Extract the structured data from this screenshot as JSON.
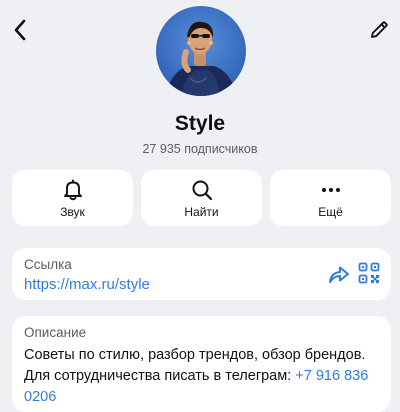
{
  "header": {
    "back_icon": "chevron-left-icon",
    "edit_icon": "pencil-icon"
  },
  "channel": {
    "name": "Style",
    "subscribers": "27 935 подписчиков"
  },
  "actions": [
    {
      "label": "Звук",
      "icon": "bell-icon"
    },
    {
      "label": "Найти",
      "icon": "search-icon"
    },
    {
      "label": "Ещё",
      "icon": "more-icon"
    }
  ],
  "link_card": {
    "title": "Ссылка",
    "url": "https://max.ru/style",
    "share_icon": "share-icon",
    "qr_icon": "qr-code-icon"
  },
  "description_card": {
    "title": "Описание",
    "text": "Советы по стилю, разбор трендов, обзор брендов. Для сотрудничества писать в телеграм: ",
    "phone": "+7 916 836 0206"
  },
  "colors": {
    "background": "#eff0f4",
    "card": "#ffffff",
    "link": "#2f7ce0",
    "secondary_text": "#5b5d63"
  }
}
